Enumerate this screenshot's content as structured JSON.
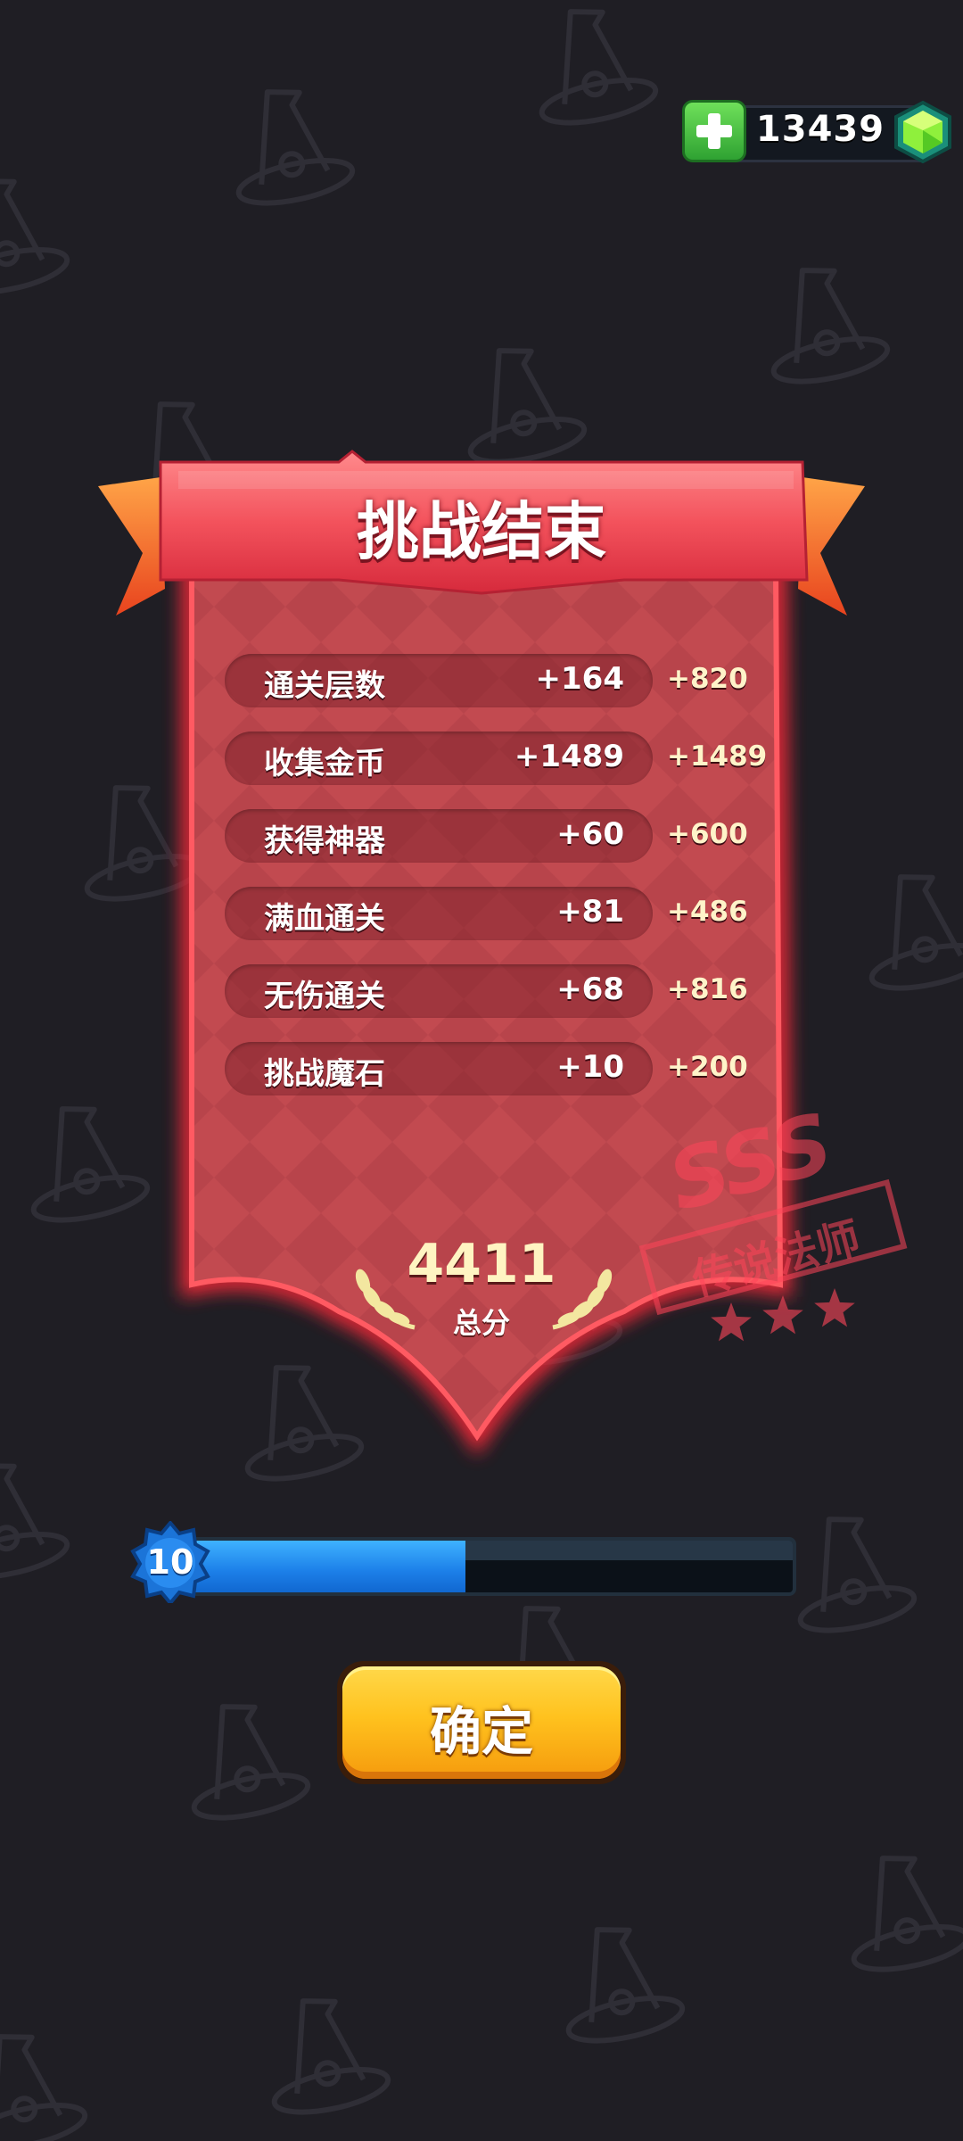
{
  "currency": {
    "amount": "13439",
    "icon": "green-gem-icon",
    "add_icon": "plus-icon"
  },
  "result": {
    "title": "挑战结束",
    "rows": [
      {
        "label": "通关层数",
        "count": "+164",
        "points": "+820"
      },
      {
        "label": "收集金币",
        "count": "+1489",
        "points": "+1489"
      },
      {
        "label": "获得神器",
        "count": "+60",
        "points": "+600"
      },
      {
        "label": "满血通关",
        "count": "+81",
        "points": "+486"
      },
      {
        "label": "无伤通关",
        "count": "+68",
        "points": "+816"
      },
      {
        "label": "挑战魔石",
        "count": "+10",
        "points": "+200"
      }
    ],
    "total_value": "4411",
    "total_label": "总分"
  },
  "rank": {
    "grade": "SSS",
    "title": "传说法师",
    "stars": 3
  },
  "level": {
    "number": "10",
    "progress": 0.46
  },
  "confirm": {
    "label": "确定"
  },
  "colors": {
    "background": "#1f1e24",
    "banner": "#f0505a",
    "panel": "#c2454c",
    "level_fill": "#1c7fe8",
    "button": "#ffc21e"
  }
}
